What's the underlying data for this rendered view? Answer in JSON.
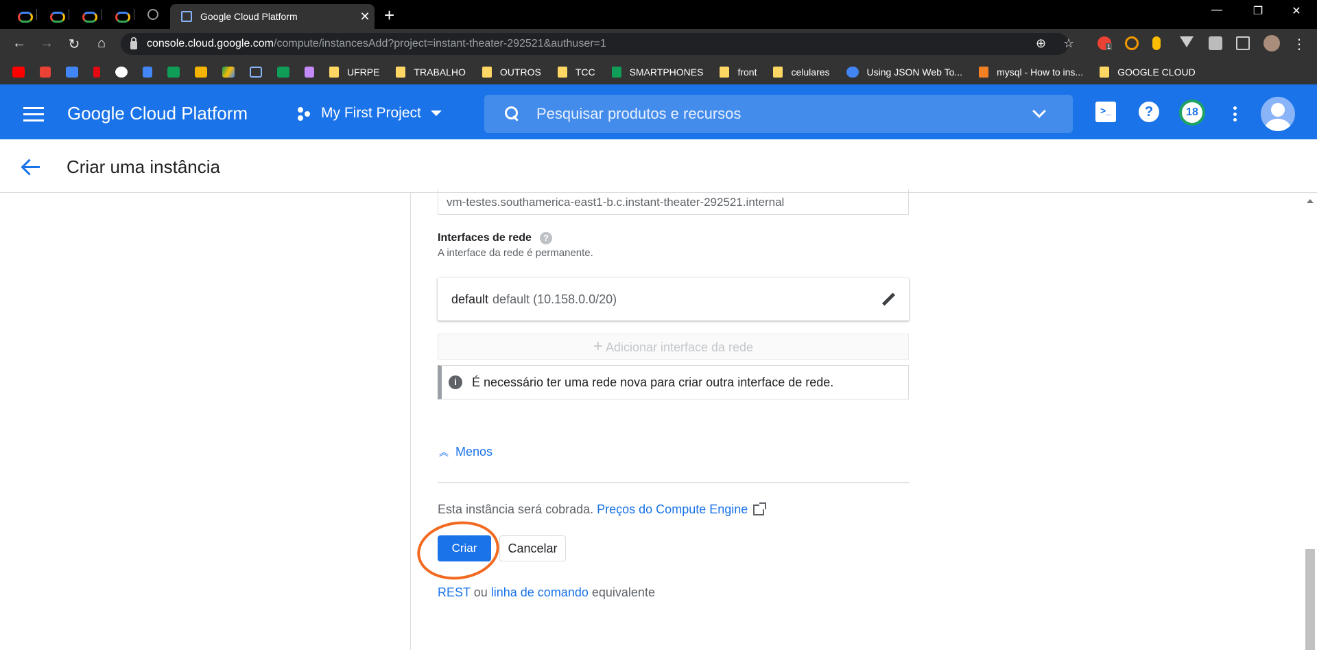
{
  "browser": {
    "active_tab_title": "Google Cloud Platform",
    "url_host": "console.cloud.google.com",
    "url_path": "/compute/instancesAdd?project=instant-theater-292521&authuser=1",
    "new_tab_symbol": "+",
    "close_symbol": "✕",
    "bookmarks": [
      "UFRPE",
      "TRABALHO",
      "OUTROS",
      "TCC",
      "SMARTPHONES",
      "front",
      "celulares",
      "Using JSON Web To...",
      "mysql - How to ins...",
      "GOOGLE CLOUD"
    ],
    "extension_badge": "1"
  },
  "header": {
    "brand": "Google Cloud Platform",
    "project": "My First Project",
    "search_placeholder": "Pesquisar produtos e recursos",
    "notifications_count": "18"
  },
  "page": {
    "title": "Criar uma instância",
    "hostname_value": "vm-testes.southamerica-east1-b.c.instant-theater-292521.internal",
    "network_label": "Interfaces de rede",
    "network_sub": "A interface da rede é permanente.",
    "network_name": "default",
    "network_detail": "default (10.158.0.0/20)",
    "add_interface": "Adicionar interface da rede",
    "info_text": "É necessário ter uma rede nova para criar outra interface de rede.",
    "less_link": "Menos",
    "billing_text": "Esta instância será cobrada.",
    "billing_link": "Preços do Compute Engine",
    "create_button": "Criar",
    "cancel_button": "Cancelar",
    "rest_link": "REST",
    "rest_or": "ou",
    "cli_link": "linha de comando",
    "rest_equiv": "equivalente"
  },
  "colors": {
    "header_blue": "#1a73e8",
    "annotation_orange": "#f26a21"
  }
}
